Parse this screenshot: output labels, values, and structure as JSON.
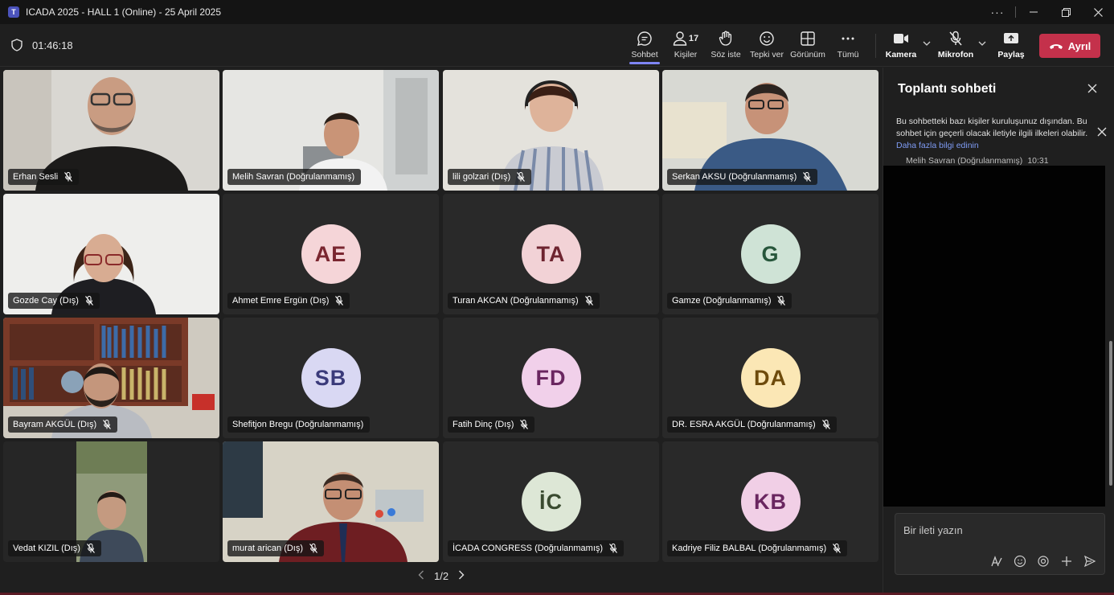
{
  "window": {
    "title": "ICADA 2025 - HALL 1 (Online) - 25 April 2025",
    "more_label": "···"
  },
  "meeting": {
    "timer": "01:46:18"
  },
  "toolbar": {
    "chat_label": "Sohbet",
    "people_label": "Kişiler",
    "people_count": "17",
    "raise_label": "Söz iste",
    "react_label": "Tepki ver",
    "view_label": "Görünüm",
    "more_label": "Tümü",
    "camera_label": "Kamera",
    "mic_label": "Mikrofon",
    "share_label": "Paylaş",
    "leave_label": "Ayrıl"
  },
  "participants": [
    {
      "name": "Erhan Sesli",
      "type": "video"
    },
    {
      "name": "Melih Savran (Doğrulanmamış)",
      "type": "video"
    },
    {
      "name": "lili golzari (Dış)",
      "type": "video"
    },
    {
      "name": "Serkan AKSU (Doğrulanmamış)",
      "type": "video"
    },
    {
      "name": "Gozde Cay (Dış)",
      "type": "video"
    },
    {
      "name": "Ahmet Emre Ergün (Dış)",
      "type": "avatar",
      "initials": "AE",
      "bg": "#f5d5d8",
      "fg": "#7a2630"
    },
    {
      "name": "Turan AKCAN (Doğrulanmamış)",
      "type": "avatar",
      "initials": "TA",
      "bg": "#f2d2d6",
      "fg": "#6e2430"
    },
    {
      "name": "Gamze (Doğrulanmamış)",
      "type": "avatar",
      "initials": "G",
      "bg": "#cfe3d6",
      "fg": "#27563b"
    },
    {
      "name": "Bayram AKGÜL (Dış)",
      "type": "video"
    },
    {
      "name": "Shefitjon Bregu (Doğrulanmamış)",
      "type": "avatar",
      "initials": "SB",
      "bg": "#d9d8f3",
      "fg": "#3a3a7a"
    },
    {
      "name": "Fatih Dinç (Dış)",
      "type": "avatar",
      "initials": "FD",
      "bg": "#f1d0ea",
      "fg": "#6a2660"
    },
    {
      "name": "DR. ESRA AKGÜL (Doğrulanmamış)",
      "type": "avatar",
      "initials": "DA",
      "bg": "#fbe7b5",
      "fg": "#6e4b0c"
    },
    {
      "name": "Vedat KIZIL (Dış)",
      "type": "video"
    },
    {
      "name": "murat arican (Dış)",
      "type": "video"
    },
    {
      "name": "İCADA CONGRESS (Doğrulanmamış)",
      "type": "avatar",
      "initials": "İC",
      "bg": "#dde7d6",
      "fg": "#3a4b30"
    },
    {
      "name": "Kadriye Filiz BALBAL (Doğrulanmamış)",
      "type": "avatar",
      "initials": "KB",
      "bg": "#f1cfe6",
      "fg": "#6a2660"
    }
  ],
  "pager": {
    "label": "1/2"
  },
  "chat": {
    "title": "Toplantı sohbeti",
    "notice_text": "Bu sohbetteki bazı kişiler kuruluşunuz dışından. Bu sohbet için geçerli olacak iletiyle ilgili ilkeleri olabilir.",
    "notice_link": "Daha fazla bilgi edinin",
    "last_sender": "Melih Savran (Doğrulanmamış)",
    "last_time": "10:31",
    "compose_placeholder": "Bir ileti yazın"
  },
  "colors": {
    "accent": "#7f85f5",
    "leave": "#c4314b"
  }
}
